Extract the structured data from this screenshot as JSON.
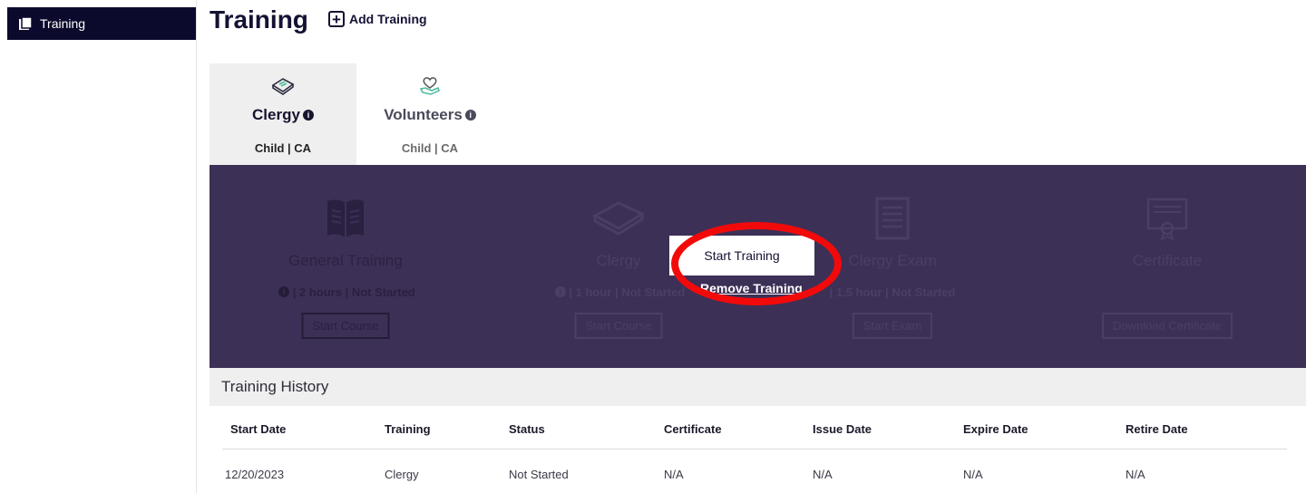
{
  "sidebar": {
    "items": [
      {
        "label": "Training",
        "icon": "training-book-icon"
      }
    ]
  },
  "header": {
    "title": "Training",
    "add_label": "Add Training",
    "add_icon": "plus-square-icon"
  },
  "tabs": [
    {
      "name": "Clergy",
      "sub": "Child | CA",
      "icon": "book-icon",
      "active": true
    },
    {
      "name": "Volunteers",
      "sub": "Child | CA",
      "icon": "heart-hand-icon",
      "active": false
    }
  ],
  "cards": [
    {
      "title": "General Training",
      "meta": "| 2 hours | Not Started",
      "button": "Start Course",
      "icon": "open-book-icon"
    },
    {
      "title": "Clergy",
      "meta": "| 1 hour | Not Started",
      "button": "Start Course",
      "icon": "book-icon"
    },
    {
      "title": "Clergy Exam",
      "meta": "| 1.5 hour | Not Started",
      "button": "Start Exam",
      "icon": "exam-document-icon"
    },
    {
      "title": "Certificate",
      "meta": "",
      "button": "Download Certificate",
      "icon": "certificate-icon"
    }
  ],
  "overlay": {
    "start_label": "Start Training",
    "remove_label": "Remove Training",
    "ring_color": "#f20a0a"
  },
  "history": {
    "title": "Training History",
    "columns": [
      "Start Date",
      "Training",
      "Status",
      "Certificate",
      "Issue Date",
      "Expire Date",
      "Retire Date"
    ],
    "rows": [
      [
        "12/20/2023",
        "Clergy",
        "Not Started",
        "N/A",
        "N/A",
        "N/A",
        "N/A"
      ]
    ]
  },
  "colors": {
    "sidebar_active": "#0c0a2c",
    "panel": "#3d3056",
    "tab_active": "#efefef"
  }
}
